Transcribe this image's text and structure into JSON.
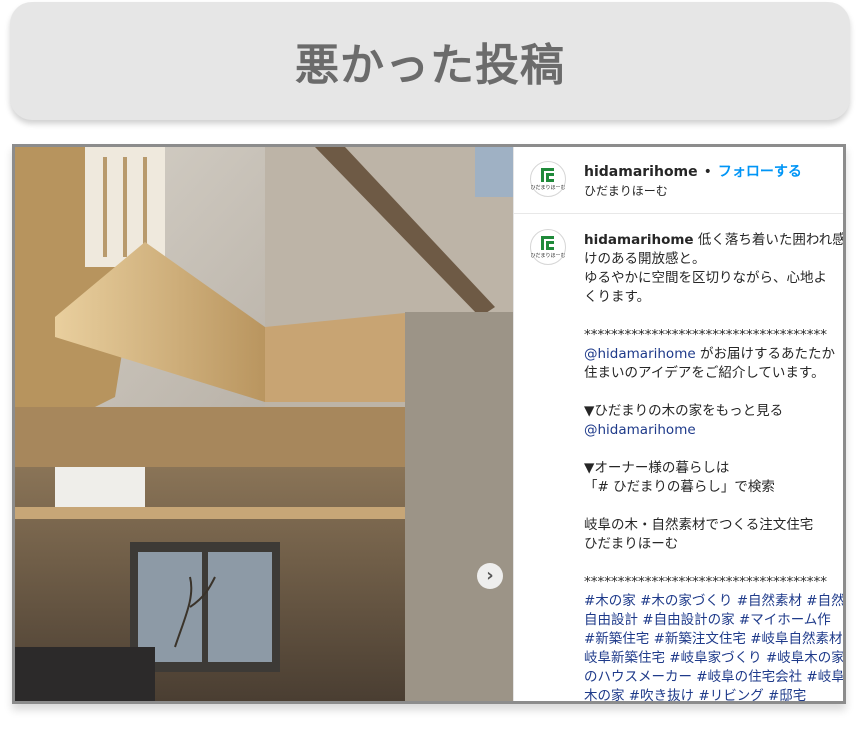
{
  "banner": {
    "title": "悪かった投稿"
  },
  "post": {
    "username": "hidamarihome",
    "separator": "•",
    "follow_label": "フォローする",
    "display_name": "ひだまりほーむ",
    "avatar_text": "ひだまりほーむ",
    "next_icon": "chevron-right-icon",
    "caption_lines": [
      {
        "text": " 低く落ち着いた囲われ感",
        "lead": "hidamarihome"
      },
      {
        "text": "けのある開放感と。"
      },
      {
        "text": "ゆるやかに空間を区切りながら、心地よ"
      },
      {
        "text": "くります。"
      },
      {
        "text": ""
      },
      {
        "text": "************************************"
      },
      {
        "text": " がお届けするあたたか",
        "mention": "@hidamarihome"
      },
      {
        "text": "住まいのアイデアをご紹介しています。"
      },
      {
        "text": ""
      },
      {
        "text": "▼ひだまりの木の家をもっと見る"
      },
      {
        "text": "",
        "mention": "@hidamarihome"
      },
      {
        "text": ""
      },
      {
        "text": "▼オーナー様の暮らしは"
      },
      {
        "text": "「# ひだまりの暮らし」で検索"
      },
      {
        "text": ""
      },
      {
        "text": "岐阜の木・自然素材でつくる注文住宅"
      },
      {
        "text": "ひだまりほーむ"
      },
      {
        "text": ""
      },
      {
        "text": "************************************"
      },
      {
        "text": "#木の家 #木の家づくり #自然素材 #自然",
        "tag": true
      },
      {
        "text": "自由設計 #自由設計の家 #マイホーム作",
        "tag": true
      },
      {
        "text": "#新築住宅 #新築注文住宅 #岐阜自然素材",
        "tag": true
      },
      {
        "text": "岐阜新築住宅 #岐阜家づくり #岐阜木の家",
        "tag": true
      },
      {
        "text": "のハウスメーカー #岐阜の住宅会社 #岐阜",
        "tag": true
      },
      {
        "text": "木の家 #吹き抜け #リビング #邸宅",
        "tag": true
      }
    ]
  },
  "colors": {
    "follow": "#0095f6",
    "link": "#1e3a8a",
    "banner_bg": "#e6e6e6",
    "banner_text": "#6b6b6b"
  }
}
